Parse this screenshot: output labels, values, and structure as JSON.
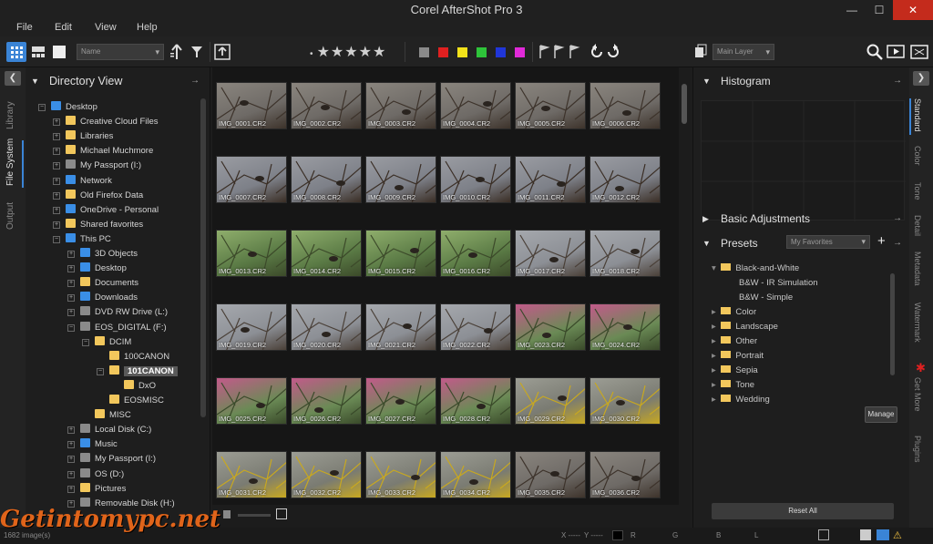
{
  "app": {
    "title": "Corel AfterShot Pro 3"
  },
  "menu": [
    "File",
    "Edit",
    "View",
    "Help"
  ],
  "toolbar": {
    "sort_value": "Name",
    "layer_value": "Main Layer",
    "label_colors": [
      "#8a8a8a",
      "#e02020",
      "#f2e21a",
      "#2ec43a",
      "#2036d8",
      "#e02ad8"
    ]
  },
  "left_tabs": [
    "Library",
    "File System",
    "Output"
  ],
  "directory": {
    "title": "Directory View",
    "items": [
      {
        "label": "Desktop",
        "indent": 0,
        "icon": "blue",
        "pm": "−"
      },
      {
        "label": "Creative Cloud Files",
        "indent": 1,
        "icon": "folder",
        "pm": "+"
      },
      {
        "label": "Libraries",
        "indent": 1,
        "icon": "folder",
        "pm": "+"
      },
      {
        "label": "Michael Muchmore",
        "indent": 1,
        "icon": "folder",
        "pm": "+"
      },
      {
        "label": "My Passport (I:)",
        "indent": 1,
        "icon": "drive",
        "pm": "+"
      },
      {
        "label": "Network",
        "indent": 1,
        "icon": "blue",
        "pm": "+"
      },
      {
        "label": "Old Firefox Data",
        "indent": 1,
        "icon": "folder",
        "pm": "+"
      },
      {
        "label": "OneDrive - Personal",
        "indent": 1,
        "icon": "blue",
        "pm": "+"
      },
      {
        "label": "Shared favorites",
        "indent": 1,
        "icon": "folder",
        "pm": "+"
      },
      {
        "label": "This PC",
        "indent": 1,
        "icon": "blue",
        "pm": "−"
      },
      {
        "label": "3D Objects",
        "indent": 2,
        "icon": "blue",
        "pm": "+"
      },
      {
        "label": "Desktop",
        "indent": 2,
        "icon": "blue",
        "pm": "+"
      },
      {
        "label": "Documents",
        "indent": 2,
        "icon": "folder",
        "pm": "+"
      },
      {
        "label": "Downloads",
        "indent": 2,
        "icon": "blue",
        "pm": "+"
      },
      {
        "label": "DVD RW Drive (L:)",
        "indent": 2,
        "icon": "drive",
        "pm": "+"
      },
      {
        "label": "EOS_DIGITAL (F:)",
        "indent": 2,
        "icon": "drive",
        "pm": "−"
      },
      {
        "label": "DCIM",
        "indent": 3,
        "icon": "folder",
        "pm": "−"
      },
      {
        "label": "100CANON",
        "indent": 4,
        "icon": "folder",
        "pm": ""
      },
      {
        "label": "101CANON",
        "indent": 4,
        "icon": "folder",
        "pm": "−",
        "selected": true
      },
      {
        "label": "DxO",
        "indent": 5,
        "icon": "folder",
        "pm": ""
      },
      {
        "label": "EOSMISC",
        "indent": 4,
        "icon": "folder",
        "pm": ""
      },
      {
        "label": "MISC",
        "indent": 3,
        "icon": "folder",
        "pm": ""
      },
      {
        "label": "Local Disk (C:)",
        "indent": 2,
        "icon": "drive",
        "pm": "+"
      },
      {
        "label": "Music",
        "indent": 2,
        "icon": "blue",
        "pm": "+"
      },
      {
        "label": "My Passport (I:)",
        "indent": 2,
        "icon": "drive",
        "pm": "+"
      },
      {
        "label": "OS (D:)",
        "indent": 2,
        "icon": "drive",
        "pm": "+"
      },
      {
        "label": "Pictures",
        "indent": 2,
        "icon": "folder",
        "pm": "+"
      },
      {
        "label": "Removable Disk (H:)",
        "indent": 2,
        "icon": "drive",
        "pm": "+"
      }
    ]
  },
  "thumbnails": [
    "IMG_0001.CR2",
    "IMG_0002.CR2",
    "IMG_0003.CR2",
    "IMG_0004.CR2",
    "IMG_0005.CR2",
    "IMG_0006.CR2",
    "IMG_0007.CR2",
    "IMG_0008.CR2",
    "IMG_0009.CR2",
    "IMG_0010.CR2",
    "IMG_0011.CR2",
    "IMG_0012.CR2",
    "IMG_0013.CR2",
    "IMG_0014.CR2",
    "IMG_0015.CR2",
    "IMG_0016.CR2",
    "IMG_0017.CR2",
    "IMG_0018.CR2",
    "IMG_0019.CR2",
    "IMG_0020.CR2",
    "IMG_0021.CR2",
    "IMG_0022.CR2",
    "IMG_0023.CR2",
    "IMG_0024.CR2",
    "IMG_0025.CR2",
    "IMG_0026.CR2",
    "IMG_0027.CR2",
    "IMG_0028.CR2",
    "IMG_0029.CR2",
    "IMG_0030.CR2",
    "IMG_0031.CR2",
    "IMG_0032.CR2",
    "IMG_0033.CR2",
    "IMG_0034.CR2",
    "IMG_0035.CR2",
    "IMG_0036.CR2"
  ],
  "right_panel": {
    "histogram_title": "Histogram",
    "basic_adjustments": "Basic Adjustments",
    "presets_title": "Presets",
    "presets_dropdown": "My Favorites",
    "presets": [
      {
        "label": "Black-and-White",
        "level": 0,
        "folder": true,
        "expanded": true
      },
      {
        "label": "B&W - IR Simulation",
        "level": 1,
        "folder": false
      },
      {
        "label": "B&W - Simple",
        "level": 1,
        "folder": false
      },
      {
        "label": "Color",
        "level": 0,
        "folder": true
      },
      {
        "label": "Landscape",
        "level": 0,
        "folder": true
      },
      {
        "label": "Other",
        "level": 0,
        "folder": true
      },
      {
        "label": "Portrait",
        "level": 0,
        "folder": true
      },
      {
        "label": "Sepia",
        "level": 0,
        "folder": true
      },
      {
        "label": "Tone",
        "level": 0,
        "folder": true
      },
      {
        "label": "Wedding",
        "level": 0,
        "folder": true
      }
    ],
    "manage_label": "Manage",
    "reset_label": "Reset All"
  },
  "right_tabs": [
    "Standard",
    "Color",
    "Tone",
    "Detail",
    "Metadata",
    "Watermark",
    "Get More",
    "Plugins"
  ],
  "status": {
    "x": "X -----",
    "y": "Y -----",
    "r": "R",
    "g": "G",
    "b": "B",
    "l": "L",
    "count": "1682 image(s)"
  },
  "watermark_text": "Getintomypc.net"
}
